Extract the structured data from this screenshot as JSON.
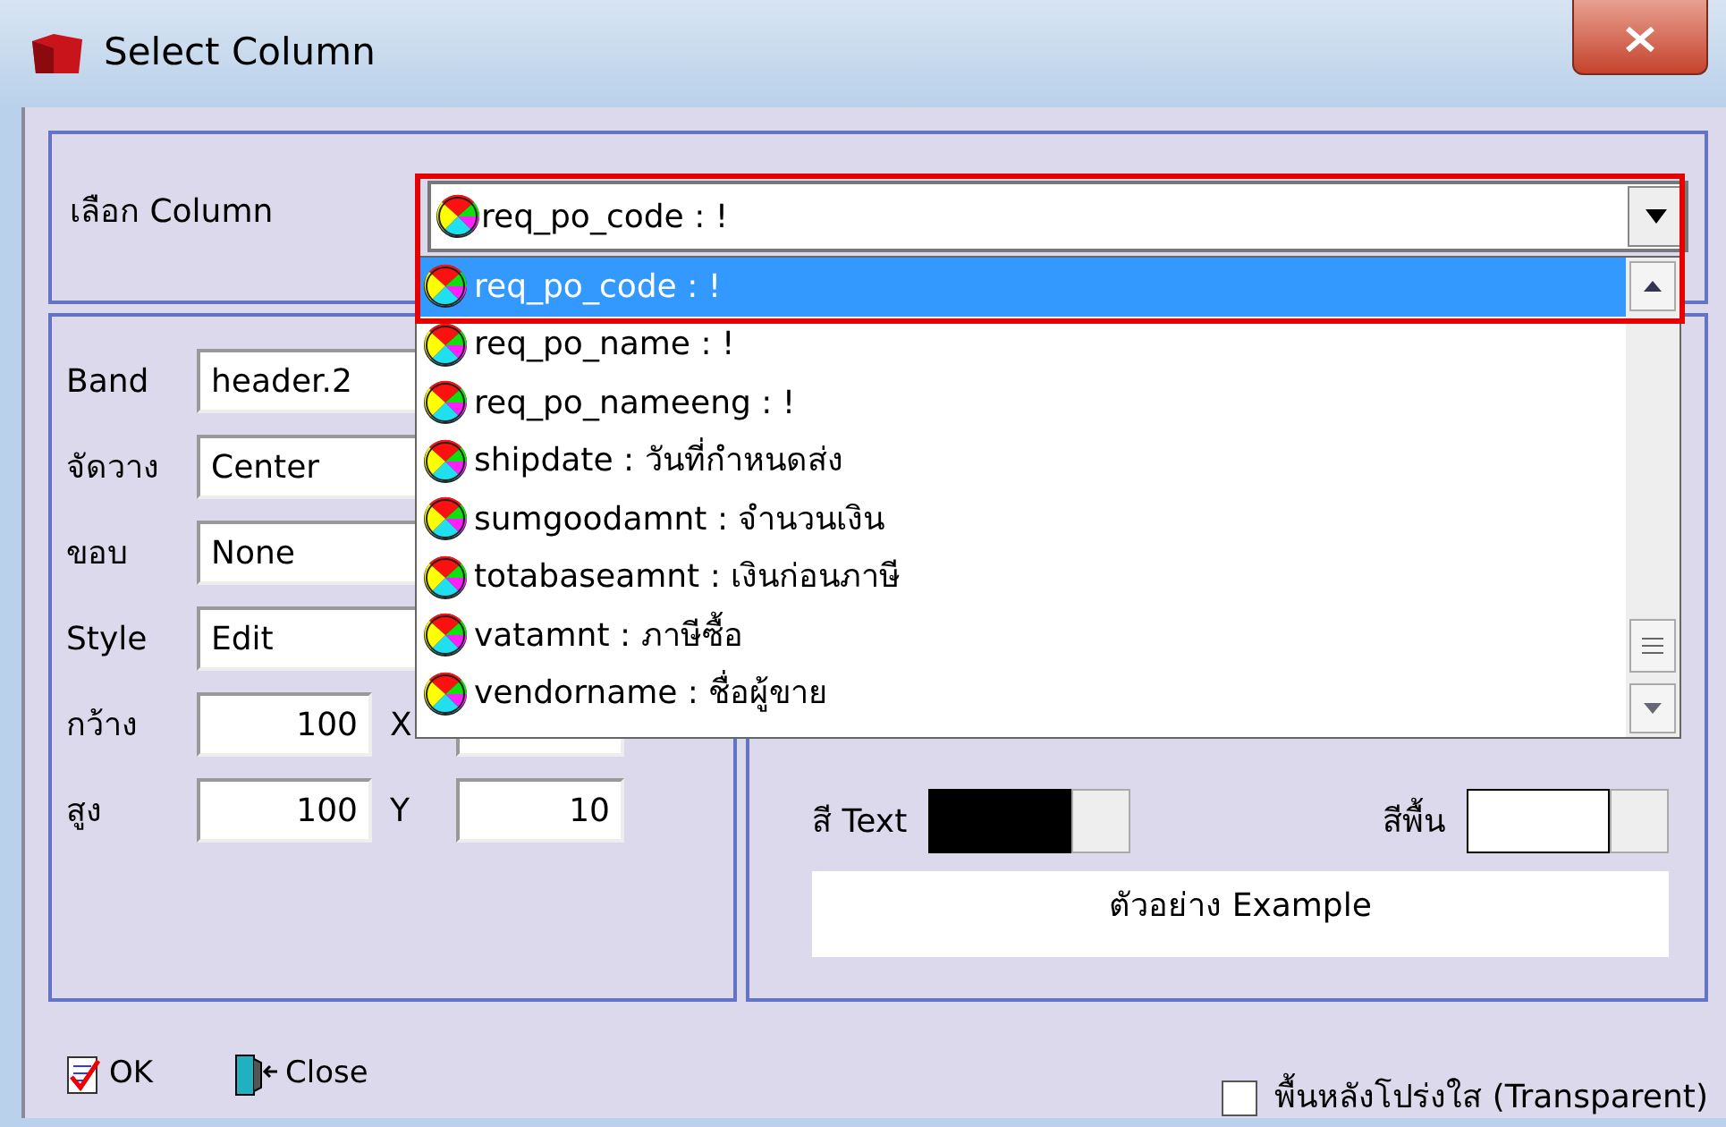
{
  "window": {
    "title": "Select Column"
  },
  "column_select": {
    "label": "เลือก Column",
    "value": "req_po_code : !",
    "expanded": true,
    "options": [
      {
        "label": "req_po_code : !",
        "selected": true
      },
      {
        "label": "req_po_name : !",
        "selected": false
      },
      {
        "label": "req_po_nameeng : !",
        "selected": false
      },
      {
        "label": "shipdate : วันที่กำหนดส่ง",
        "selected": false
      },
      {
        "label": "sumgoodamnt : จำนวนเงิน",
        "selected": false
      },
      {
        "label": "totabaseamnt : เงินก่อนภาษี",
        "selected": false
      },
      {
        "label": "vatamnt : ภาษีซื้อ",
        "selected": false
      },
      {
        "label": "vendorname : ชื่อผู้ขาย",
        "selected": false
      }
    ]
  },
  "properties": [
    {
      "label": "Band",
      "value": "header.2",
      "kind": "text"
    },
    {
      "label": "จัดวาง",
      "value": "Center",
      "kind": "text"
    },
    {
      "label": "ขอบ",
      "value": "None",
      "kind": "text"
    },
    {
      "label": "Style",
      "value": "Edit",
      "kind": "text"
    },
    {
      "label": "กว้าง",
      "value": "100",
      "kind": "pair",
      "coord": {
        "label": "X"
      }
    },
    {
      "label": "สูง",
      "value": "100",
      "kind": "pair",
      "coord": {
        "label": "Y",
        "value": "10"
      }
    }
  ],
  "colors": [
    {
      "label": "สี Text",
      "color": "#000000"
    },
    {
      "label": "สีพื้น",
      "color": "#ffffff"
    }
  ],
  "preview": "ตัวอย่าง Example",
  "buttons": [
    {
      "label": "OK",
      "kind": "ok"
    },
    {
      "label": "Close",
      "kind": "close"
    }
  ],
  "transparent": {
    "label": "พื้นหลังโปร่งใส (Transparent)",
    "checked": false
  }
}
